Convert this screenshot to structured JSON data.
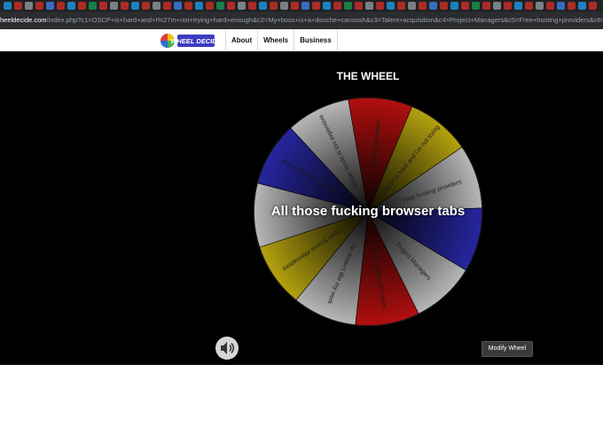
{
  "browser": {
    "url_host": "heeldecide.com",
    "url_path": "/index.php?c1=OSCP+is+hard+and+I%27m+not+trying+hard+enough&c2=My+boss+is+a+douche+canoosh&c3=Talent+acquisition&c4=Project+Managers&c5=Free+hosting+providers&c6=H"
  },
  "site": {
    "logo_text": "WHEEL DECIDE",
    "nav": [
      "About",
      "Wheels",
      "Business"
    ]
  },
  "wheel": {
    "title": "THE WHEEL",
    "result": "All those fucking browser tabs",
    "slices": [
      {
        "label": "Talent acquisition",
        "color": "#b30f0f"
      },
      {
        "label": "OSCP is hard and I'm not trying",
        "color": "#b5a20f"
      },
      {
        "label": "Free hosting providers",
        "color": "#b7b7b7"
      },
      {
        "label": "",
        "color": "#2626a0"
      },
      {
        "label": "Project Managers",
        "color": "#b7b7b7"
      },
      {
        "label": "Free hosting providers",
        "color": "#b30f0f"
      },
      {
        "label": "He doesn't like my work",
        "color": "#b7b7b7"
      },
      {
        "label": "Open Source Alternatives",
        "color": "#b5a20f"
      },
      {
        "label": "",
        "color": "#b7b7b7"
      },
      {
        "label": "Gonna have a bad time",
        "color": "#2626a0"
      },
      {
        "label": "Whole foods is too expensive",
        "color": "#b7b7b7"
      }
    ]
  },
  "controls": {
    "sound_icon": "speaker-icon",
    "modify_label": "Modify Wheel"
  }
}
